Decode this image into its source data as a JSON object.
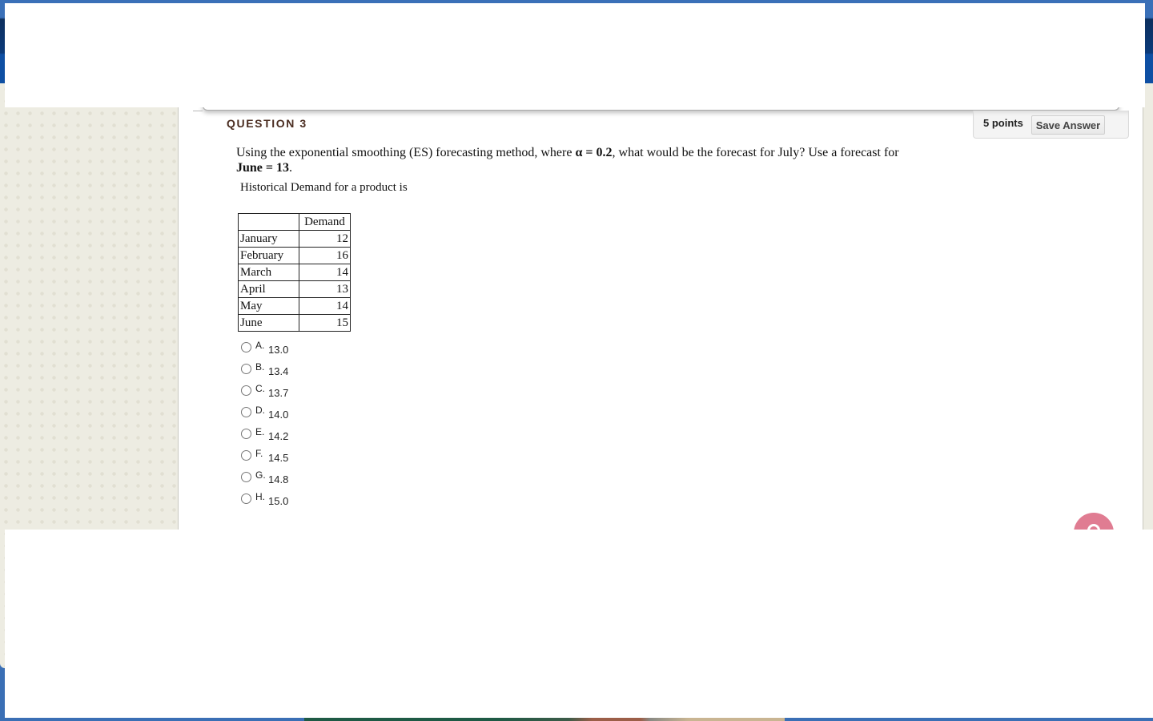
{
  "question": {
    "title": "QUESTION 3",
    "points": "5 points",
    "save_label": "Save Answer",
    "text_part1": "Using the exponential smoothing (ES) forecasting method, where ",
    "alpha_expr": "α = 0.2",
    "text_part2": ", what would be the forecast for July?  Use a forecast for ",
    "june_expr": "June = 13",
    "text_part3": ".",
    "intro": "Historical Demand for a product is"
  },
  "table": {
    "header": [
      "",
      "Demand"
    ],
    "rows": [
      {
        "month": "January",
        "demand": "12"
      },
      {
        "month": "February",
        "demand": "16"
      },
      {
        "month": "March",
        "demand": "14"
      },
      {
        "month": "April",
        "demand": "13"
      },
      {
        "month": "May",
        "demand": "14"
      },
      {
        "month": "June",
        "demand": "15"
      }
    ]
  },
  "options": [
    {
      "letter": "A.",
      "value": "13.0"
    },
    {
      "letter": "B.",
      "value": "13.4"
    },
    {
      "letter": "C.",
      "value": "13.7"
    },
    {
      "letter": "D.",
      "value": "14.0"
    },
    {
      "letter": "E.",
      "value": "14.2"
    },
    {
      "letter": "F.",
      "value": "14.5"
    },
    {
      "letter": "G.",
      "value": "14.8"
    },
    {
      "letter": "H.",
      "value": "15.0"
    }
  ],
  "colors": {
    "title": "#4a2c20",
    "help_bubble": "#e07c92",
    "page_bg": "#edece2",
    "desktop_blue": "#3a6fb5"
  }
}
